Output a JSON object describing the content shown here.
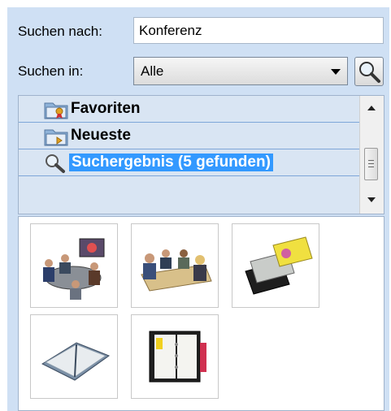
{
  "search": {
    "label": "Suchen nach:",
    "value": "Konferenz"
  },
  "scope": {
    "label": "Suchen in:",
    "selected": "Alle"
  },
  "search_button": {
    "icon": "magnifier-icon"
  },
  "categories": [
    {
      "label": "Favoriten",
      "icon": "folder-favorites-icon",
      "selected": false
    },
    {
      "label": "Neueste",
      "icon": "folder-recent-icon",
      "selected": false
    },
    {
      "label": "Suchergebnis (5 gefunden)",
      "icon": "magnifier-icon",
      "selected": true
    }
  ],
  "results": [
    {
      "icon": "conference-video-meeting-icon"
    },
    {
      "icon": "business-meeting-icon"
    },
    {
      "icon": "id-cards-icon"
    },
    {
      "icon": "notebook-icon"
    },
    {
      "icon": "planner-binder-icon"
    }
  ],
  "colors": {
    "panel_bg": "#cfe0f4",
    "selection": "#3399ff"
  }
}
